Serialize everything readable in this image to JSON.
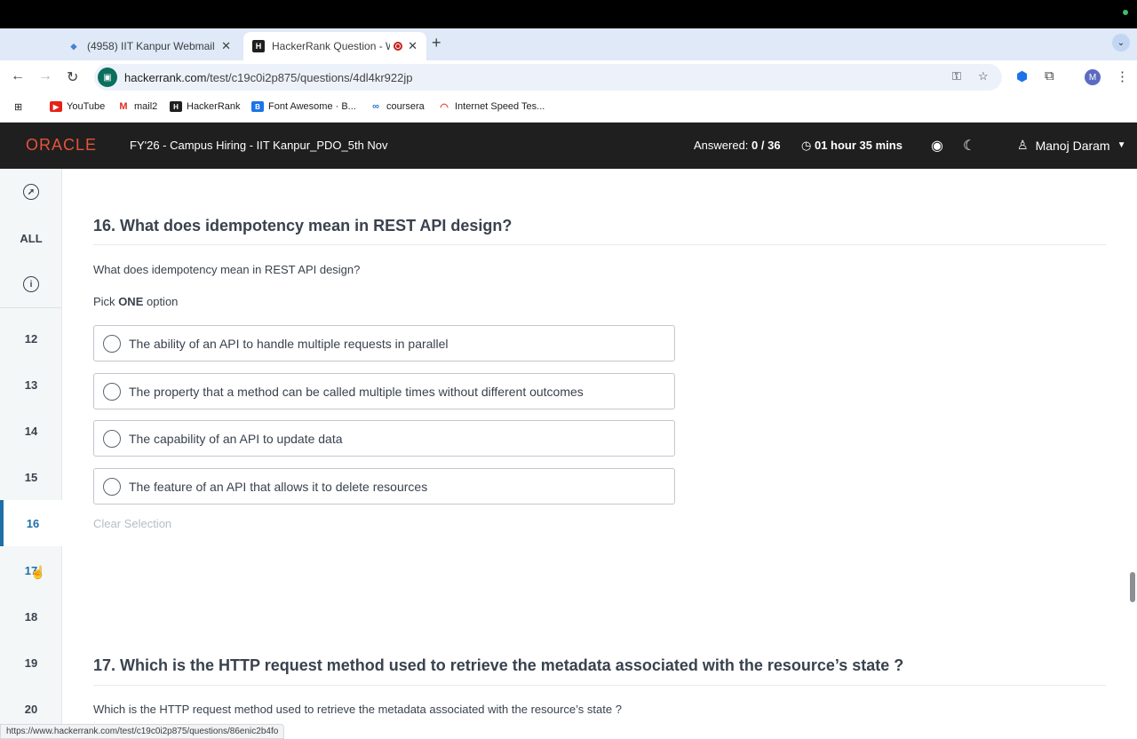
{
  "browser": {
    "tabs": [
      {
        "title": "(4958) IIT Kanpur Webmail :: ",
        "active": false
      },
      {
        "title": "HackerRank Question - W",
        "active": true
      }
    ],
    "new_tab_label": "+",
    "url_host": "hackerrank.com",
    "url_path": "/test/c19c0i2p875/questions/4dl4kr922jp",
    "profile_initial": "M",
    "bookmarks": [
      "YouTube",
      "mail2",
      "HackerRank",
      "Font Awesome · B...",
      "coursera",
      "Internet Speed Tes..."
    ],
    "status_url": "https://www.hackerrank.com/test/c19c0i2p875/questions/86enic2b4fo"
  },
  "header": {
    "logo": "ORACLE",
    "test_name": "FY'26 - Campus Hiring - IIT Kanpur_PDO_5th Nov",
    "answered_label": "Answered:",
    "answered_value": "0 / 36",
    "time_remaining": "01 hour 35 mins",
    "user_name": "Manoj Daram"
  },
  "sidebar": {
    "all_label": "ALL",
    "numbers": [
      "12",
      "13",
      "14",
      "15",
      "16",
      "17",
      "18",
      "19",
      "20"
    ],
    "active": "16"
  },
  "question16": {
    "title": "16. What does idempotency mean in REST API design?",
    "text": "What does idempotency mean in REST API design?",
    "pick_prefix": "Pick",
    "pick_bold": "ONE",
    "pick_suffix": "option",
    "options": [
      "The ability of an API to handle multiple requests in parallel",
      "The property that a method can be called multiple times without different outcomes",
      "The capability of an API to update data",
      "The feature of an API that allows it to delete resources"
    ],
    "clear_label": "Clear Selection"
  },
  "question17": {
    "title": "17. Which is the HTTP request method used to retrieve the metadata associated with the resource’s state ?",
    "text": "Which is the HTTP request method used to retrieve the metadata associated with the resource’s state ?"
  }
}
